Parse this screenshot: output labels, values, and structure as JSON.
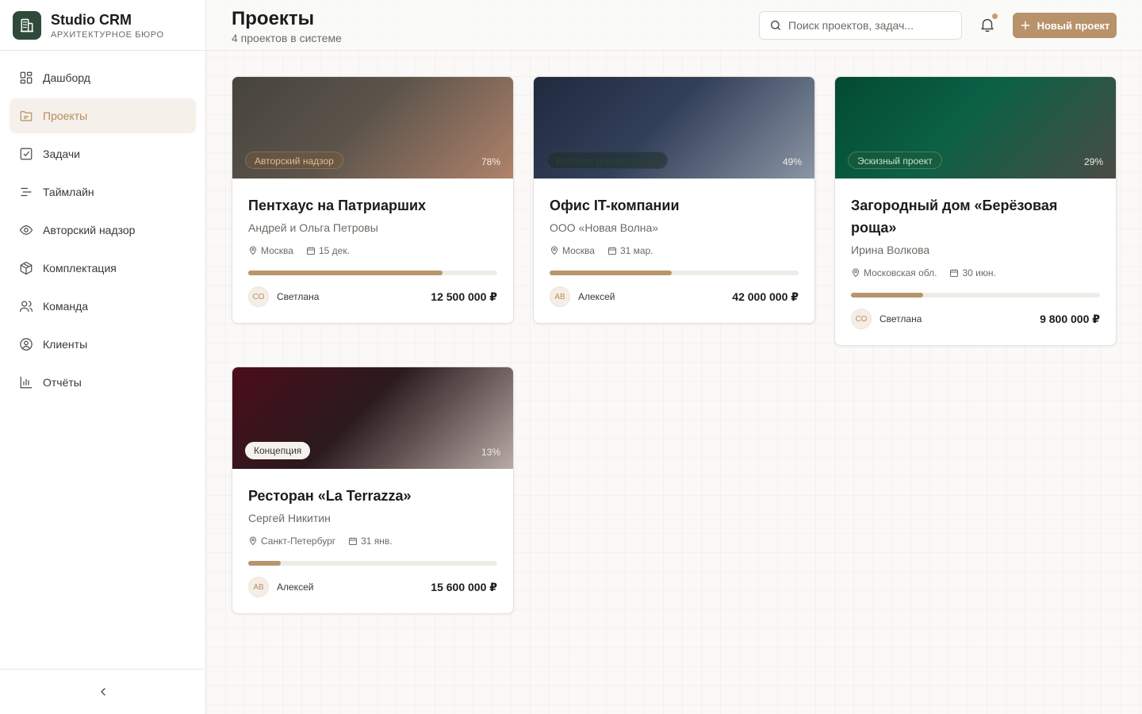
{
  "brand": {
    "name": "Studio CRM",
    "subtitle": "АРХИТЕКТУРНОЕ БЮРО"
  },
  "sidebar": {
    "items": [
      {
        "label": "Дашборд",
        "icon": "dashboard-icon"
      },
      {
        "label": "Проекты",
        "icon": "folder-icon",
        "active": true
      },
      {
        "label": "Задачи",
        "icon": "checkbox-icon"
      },
      {
        "label": "Таймлайн",
        "icon": "timeline-icon"
      },
      {
        "label": "Авторский надзор",
        "icon": "eye-icon"
      },
      {
        "label": "Комплектация",
        "icon": "box-icon"
      },
      {
        "label": "Команда",
        "icon": "users-icon"
      },
      {
        "label": "Клиенты",
        "icon": "user-circle-icon"
      },
      {
        "label": "Отчёты",
        "icon": "bar-chart-icon"
      }
    ]
  },
  "header": {
    "title": "Проекты",
    "subtitle": "4 проектов в системе",
    "search_placeholder": "Поиск проектов, задач...",
    "new_button": "Новый проект"
  },
  "colors": {
    "accent": "#b8926a",
    "brand": "#2f4a3a"
  },
  "projects": [
    {
      "stage": "Авторский надзор",
      "percent_label": "78%",
      "progress": 0.78,
      "title": "Пентхаус на Патриарших",
      "client": "Андрей и Ольга Петровы",
      "location": "Москва",
      "date": "15 дек.",
      "owner_initials": "СО",
      "owner": "Светлана",
      "budget": "12 500 000 ₽"
    },
    {
      "stage": "Рабочая документация",
      "percent_label": "49%",
      "progress": 0.49,
      "title": "Офис IT-компании",
      "client": "ООО «Новая Волна»",
      "location": "Москва",
      "date": "31 мар.",
      "owner_initials": "АВ",
      "owner": "Алексей",
      "budget": "42 000 000 ₽"
    },
    {
      "stage": "Эскизный проект",
      "percent_label": "29%",
      "progress": 0.29,
      "title": "Загородный дом «Берёзовая роща»",
      "client": "Ирина Волкова",
      "location": "Московская обл.",
      "date": "30 июн.",
      "owner_initials": "СО",
      "owner": "Светлана",
      "budget": "9 800 000 ₽"
    },
    {
      "stage": "Концепция",
      "percent_label": "13%",
      "progress": 0.13,
      "title": "Ресторан «La Terrazza»",
      "client": "Сергей Никитин",
      "location": "Санкт-Петербург",
      "date": "31 янв.",
      "owner_initials": "АВ",
      "owner": "Алексей",
      "budget": "15 600 000 ₽"
    }
  ]
}
